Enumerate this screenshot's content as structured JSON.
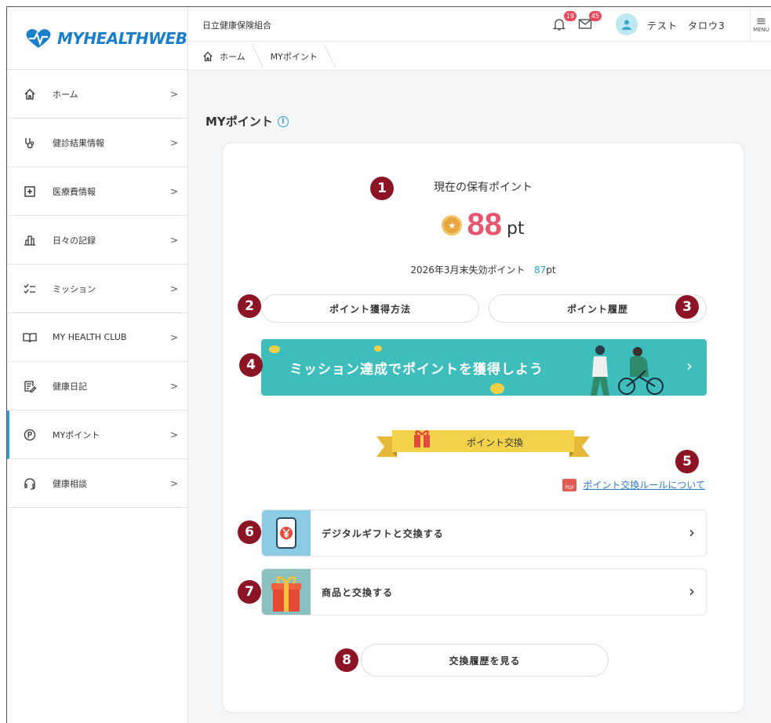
{
  "brand": {
    "logo_text": "MYHEALTHWEB"
  },
  "header": {
    "org_name": "日立健康保険組合",
    "notification_count": "19",
    "message_count": "45",
    "user_name": "テスト　タロウ3",
    "menu_label": "MENU"
  },
  "breadcrumb": {
    "home": "ホーム",
    "current": "MYポイント"
  },
  "sidebar": {
    "items": [
      {
        "label": "ホーム",
        "icon": "home-icon"
      },
      {
        "label": "健診結果情報",
        "icon": "stethoscope-icon"
      },
      {
        "label": "医療費情報",
        "icon": "medical-plus-icon"
      },
      {
        "label": "日々の記録",
        "icon": "bar-chart-icon"
      },
      {
        "label": "ミッション",
        "icon": "checklist-icon"
      },
      {
        "label": "MY HEALTH CLUB",
        "icon": "book-icon"
      },
      {
        "label": "健康日記",
        "icon": "diary-icon"
      },
      {
        "label": "MYポイント",
        "icon": "point-icon",
        "active": true
      },
      {
        "label": "健康相談",
        "icon": "headset-icon"
      }
    ],
    "chevron": ">"
  },
  "main": {
    "title": "MYポイント",
    "info_glyph": "i",
    "current_points_label": "現在の保有ポイント",
    "points_value": "88",
    "points_unit": "pt",
    "expiry_prefix": "2026年3月末失効ポイント",
    "expiry_value": "87",
    "expiry_unit": "pt",
    "earn_button": "ポイント獲得方法",
    "history_button": "ポイント履歴",
    "banner_text": "ミッション達成でポイントを獲得しよう",
    "exchange_ribbon": "ポイント交換",
    "pdf_label": "PDF",
    "rules_link": "ポイント交換ルールについて",
    "exchange_items": [
      {
        "label": "デジタルギフトと交換する",
        "icon": "phone-yen-icon"
      },
      {
        "label": "商品と交換する",
        "icon": "gift-box-icon"
      }
    ],
    "exchange_history_button": "交換履歴を見る",
    "markers": [
      "1",
      "2",
      "3",
      "4",
      "5",
      "6",
      "7",
      "8"
    ]
  },
  "colors": {
    "accent": "#2f9ed6",
    "points": "#e5566f",
    "banner": "#3fbdbd",
    "marker": "#8b1425",
    "ribbon": "#f3d24b"
  }
}
